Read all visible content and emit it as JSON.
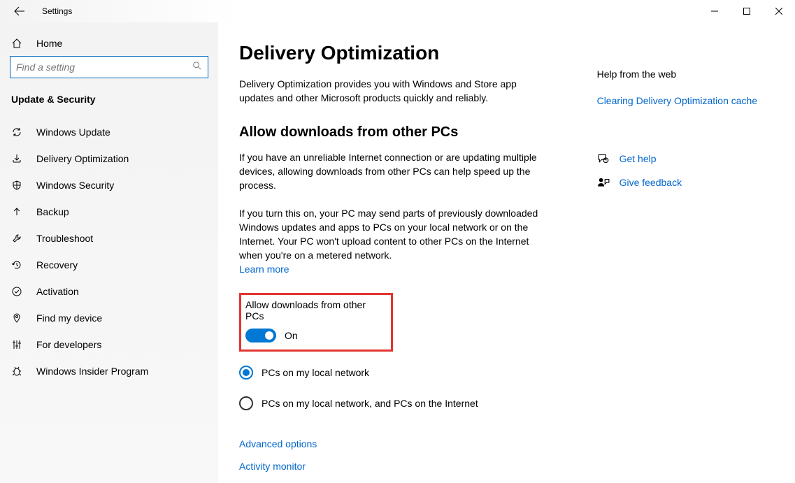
{
  "window": {
    "title": "Settings"
  },
  "sidebar": {
    "home": "Home",
    "search_placeholder": "Find a setting",
    "category": "Update & Security",
    "items": [
      {
        "icon": "refresh-icon",
        "label": "Windows Update"
      },
      {
        "icon": "download-icon",
        "label": "Delivery Optimization"
      },
      {
        "icon": "shield-icon",
        "label": "Windows Security"
      },
      {
        "icon": "arrow-up-icon",
        "label": "Backup"
      },
      {
        "icon": "wrench-icon",
        "label": "Troubleshoot"
      },
      {
        "icon": "clock-back-icon",
        "label": "Recovery"
      },
      {
        "icon": "check-circle-icon",
        "label": "Activation"
      },
      {
        "icon": "location-icon",
        "label": "Find my device"
      },
      {
        "icon": "sliders-icon",
        "label": "For developers"
      },
      {
        "icon": "bug-icon",
        "label": "Windows Insider Program"
      }
    ]
  },
  "page": {
    "title": "Delivery Optimization",
    "intro": "Delivery Optimization provides you with Windows and Store app updates and other Microsoft products quickly and reliably.",
    "section_title": "Allow downloads from other PCs",
    "para1": "If you have an unreliable Internet connection or are updating multiple devices, allowing downloads from other PCs can help speed up the process.",
    "para2": "If you turn this on, your PC may send parts of previously downloaded Windows updates and apps to PCs on your local network or on the Internet. Your PC won't upload content to other PCs on the Internet when you're on a metered network.",
    "learn_more": "Learn more",
    "toggle_label": "Allow downloads from other PCs",
    "toggle_state": "On",
    "radio1": "PCs on my local network",
    "radio2": "PCs on my local network, and PCs on the Internet",
    "advanced": "Advanced options",
    "activity": "Activity monitor"
  },
  "right": {
    "header": "Help from the web",
    "link1": "Clearing Delivery Optimization cache",
    "help": "Get help",
    "feedback": "Give feedback"
  }
}
